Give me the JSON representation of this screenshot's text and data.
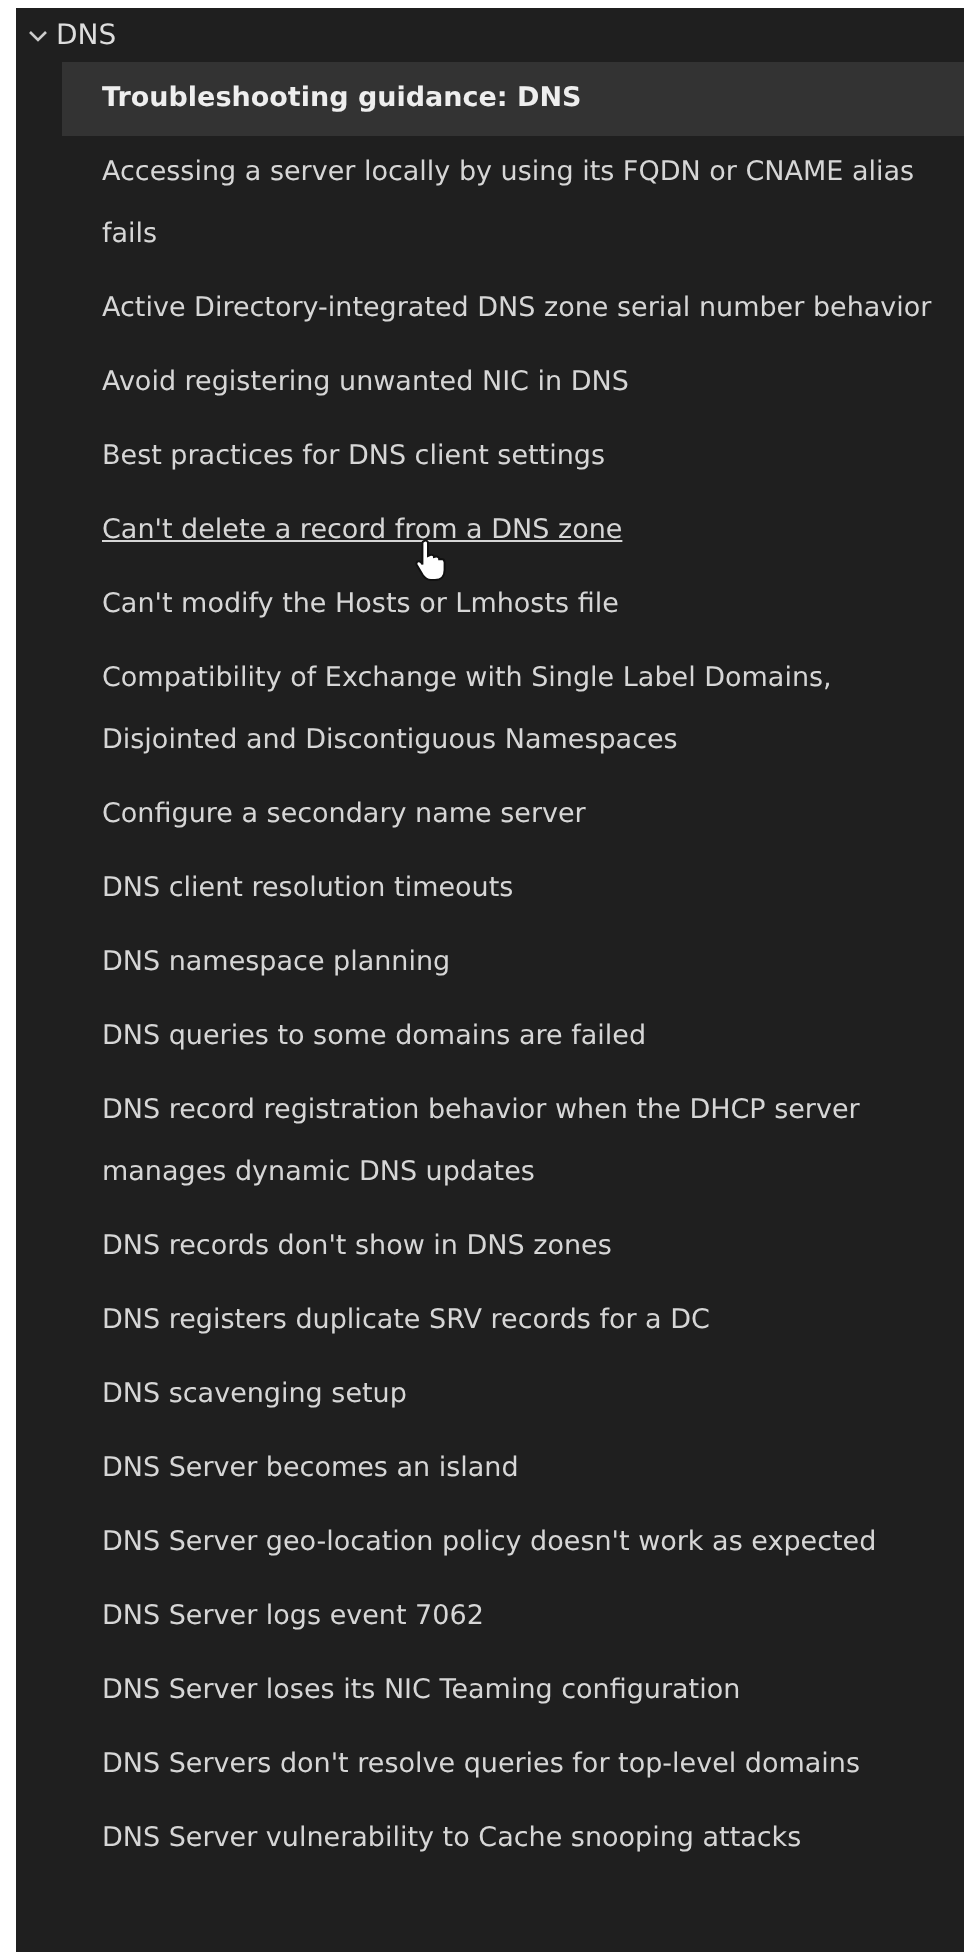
{
  "section": {
    "title": "DNS",
    "expanded": true
  },
  "items": [
    {
      "label": "Troubleshooting guidance: DNS",
      "selected": true,
      "hovered": false
    },
    {
      "label": "Accessing a server locally by using its FQDN or CNAME alias fails",
      "selected": false,
      "hovered": false
    },
    {
      "label": "Active Directory-integrated DNS zone serial number behavior",
      "selected": false,
      "hovered": false
    },
    {
      "label": "Avoid registering unwanted NIC in DNS",
      "selected": false,
      "hovered": false
    },
    {
      "label": "Best practices for DNS client settings",
      "selected": false,
      "hovered": false
    },
    {
      "label": "Can't delete a record from a DNS zone",
      "selected": false,
      "hovered": true
    },
    {
      "label": "Can't modify the Hosts or Lmhosts file",
      "selected": false,
      "hovered": false
    },
    {
      "label": "Compatibility of Exchange with Single Label Domains, Disjointed and Discontiguous Namespaces",
      "selected": false,
      "hovered": false
    },
    {
      "label": "Configure a secondary name server",
      "selected": false,
      "hovered": false
    },
    {
      "label": "DNS client resolution timeouts",
      "selected": false,
      "hovered": false
    },
    {
      "label": "DNS namespace planning",
      "selected": false,
      "hovered": false
    },
    {
      "label": "DNS queries to some domains are failed",
      "selected": false,
      "hovered": false
    },
    {
      "label": "DNS record registration behavior when the DHCP server manages dynamic DNS updates",
      "selected": false,
      "hovered": false
    },
    {
      "label": "DNS records don't show in DNS zones",
      "selected": false,
      "hovered": false
    },
    {
      "label": "DNS registers duplicate SRV records for a DC",
      "selected": false,
      "hovered": false
    },
    {
      "label": "DNS scavenging setup",
      "selected": false,
      "hovered": false
    },
    {
      "label": "DNS Server becomes an island",
      "selected": false,
      "hovered": false
    },
    {
      "label": "DNS Server geo-location policy doesn't work as expected",
      "selected": false,
      "hovered": false
    },
    {
      "label": "DNS Server logs event 7062",
      "selected": false,
      "hovered": false
    },
    {
      "label": "DNS Server loses its NIC Teaming configuration",
      "selected": false,
      "hovered": false
    },
    {
      "label": "DNS Servers don't resolve queries for top-level domains",
      "selected": false,
      "hovered": false
    },
    {
      "label": "DNS Server vulnerability to Cache snooping attacks",
      "selected": false,
      "hovered": false
    }
  ]
}
